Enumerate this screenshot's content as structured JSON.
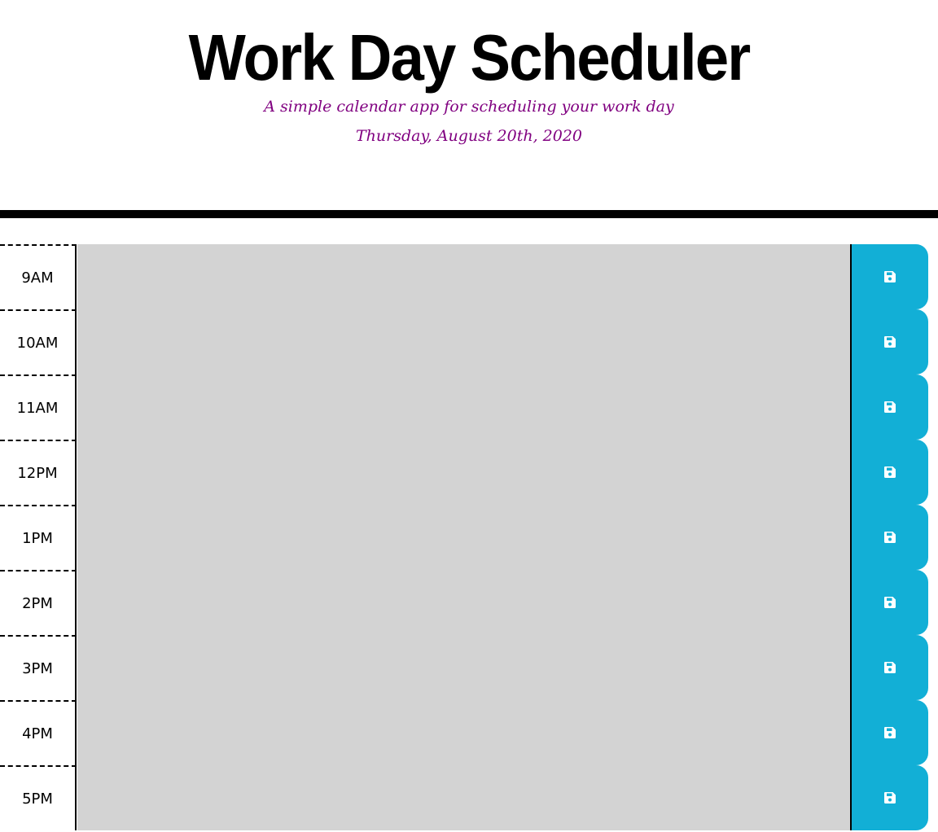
{
  "header": {
    "title": "Work Day Scheduler",
    "subtitle": "A simple calendar app for scheduling your work day",
    "current_day": "Thursday, August 20th, 2020"
  },
  "time_blocks": [
    {
      "hour": "9AM",
      "text": ""
    },
    {
      "hour": "10AM",
      "text": ""
    },
    {
      "hour": "11AM",
      "text": ""
    },
    {
      "hour": "12PM",
      "text": ""
    },
    {
      "hour": "1PM",
      "text": ""
    },
    {
      "hour": "2PM",
      "text": ""
    },
    {
      "hour": "3PM",
      "text": ""
    },
    {
      "hour": "4PM",
      "text": ""
    },
    {
      "hour": "5PM",
      "text": ""
    }
  ],
  "colors": {
    "save_button": "#12afd6",
    "textarea_bg": "#d3d3d3",
    "subtitle": "#800080",
    "header_rule": "#000000"
  },
  "icons": {
    "save": "floppy-disk-icon"
  }
}
